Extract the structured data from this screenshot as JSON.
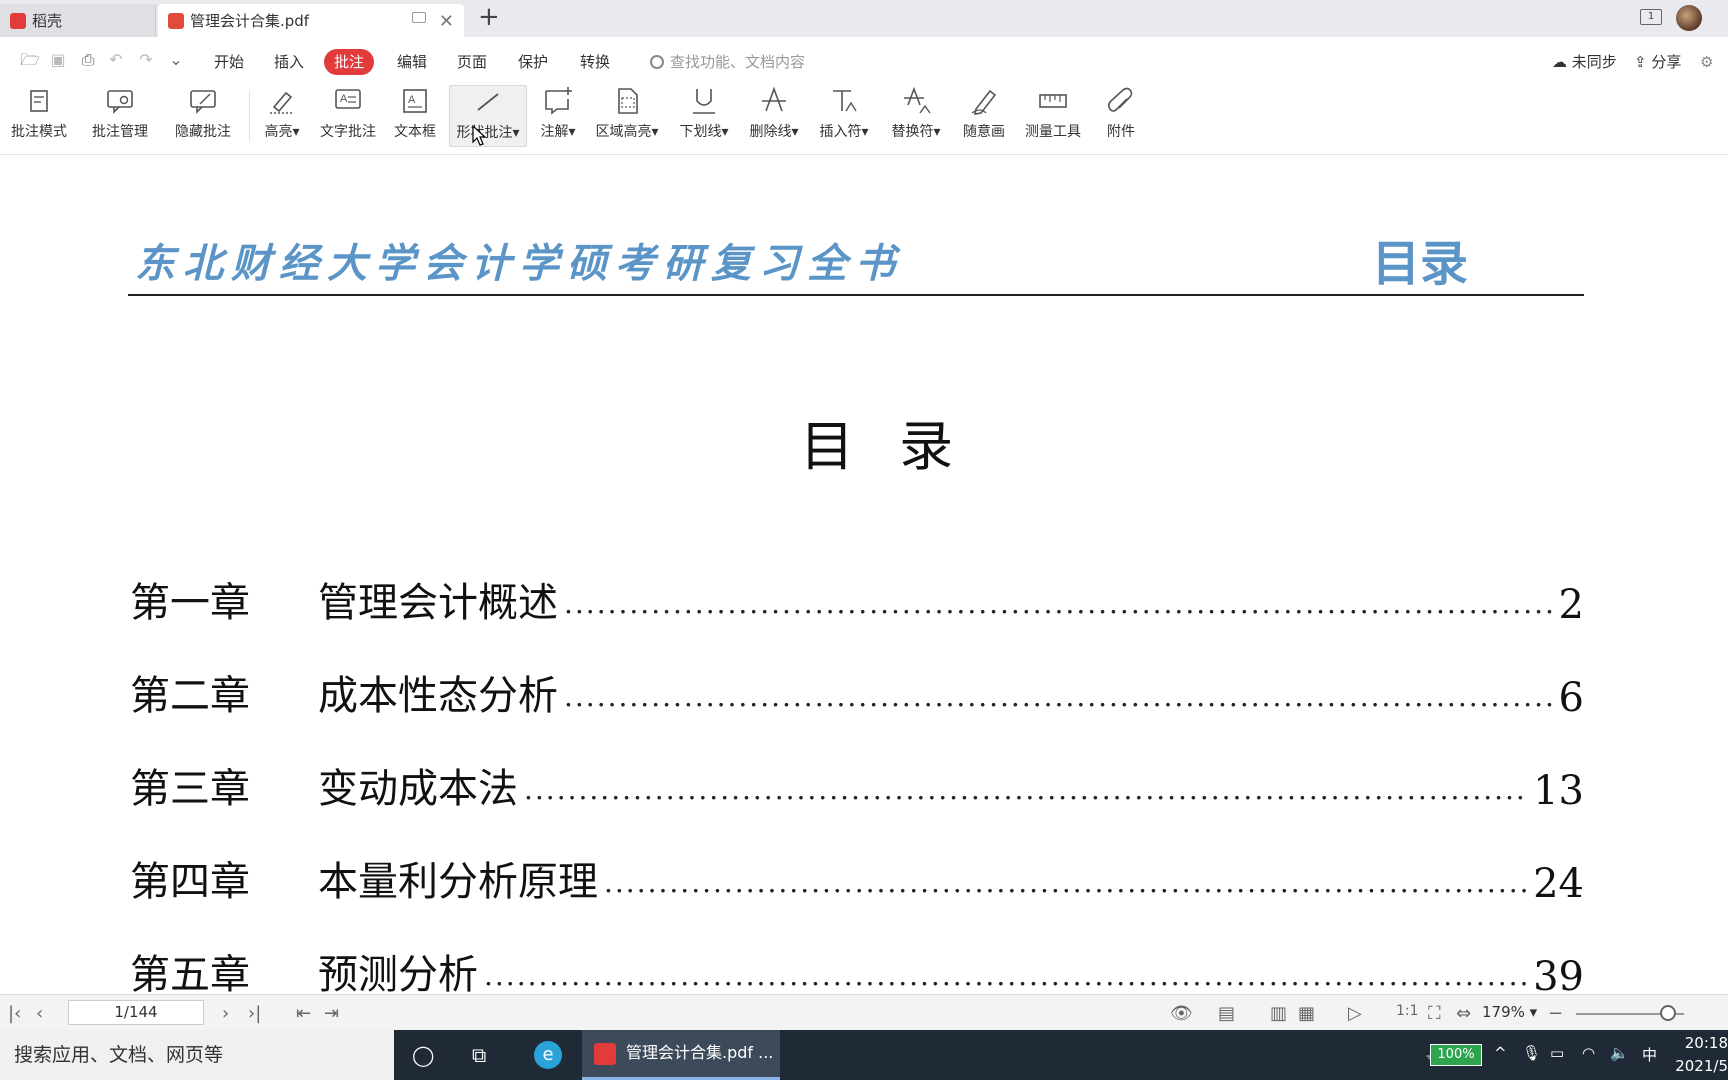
{
  "tabs": [
    {
      "label": "稻壳",
      "active": false
    },
    {
      "label": "管理会计合集.pdf",
      "active": true
    }
  ],
  "menu": {
    "items": [
      "开始",
      "插入",
      "批注",
      "编辑",
      "页面",
      "保护",
      "转换"
    ],
    "active_index": 2,
    "search_placeholder": "查找功能、文档内容",
    "sync_label": "未同步",
    "share_label": "分享"
  },
  "ribbon": {
    "buttons": [
      {
        "label": "批注模式",
        "icon": "annotation-mode-icon"
      },
      {
        "label": "批注管理",
        "icon": "annotation-manage-icon"
      },
      {
        "label": "隐藏批注",
        "icon": "hide-annotation-icon"
      },
      {
        "label": "高亮",
        "icon": "highlight-icon",
        "dropdown": true
      },
      {
        "label": "文字批注",
        "icon": "text-comment-icon"
      },
      {
        "label": "文本框",
        "icon": "textbox-icon"
      },
      {
        "label": "形状批注",
        "icon": "shape-annotation-icon",
        "dropdown": true,
        "hovered": true
      },
      {
        "label": "注解",
        "icon": "note-icon",
        "dropdown": true
      },
      {
        "label": "区域高亮",
        "icon": "area-highlight-icon",
        "dropdown": true
      },
      {
        "label": "下划线",
        "icon": "underline-icon",
        "dropdown": true
      },
      {
        "label": "删除线",
        "icon": "strikethrough-icon",
        "dropdown": true
      },
      {
        "label": "插入符",
        "icon": "insert-caret-icon",
        "dropdown": true
      },
      {
        "label": "替换符",
        "icon": "replace-caret-icon",
        "dropdown": true
      },
      {
        "label": "随意画",
        "icon": "freehand-icon"
      },
      {
        "label": "测量工具",
        "icon": "ruler-icon"
      },
      {
        "label": "附件",
        "icon": "paperclip-icon"
      }
    ]
  },
  "document": {
    "header_title": "东北财经大学会计学硕考研复习全书",
    "header_right": "目录",
    "page_title": "目 录",
    "toc": [
      {
        "chapter": "第一章",
        "title": "管理会计概述",
        "page": "2"
      },
      {
        "chapter": "第二章",
        "title": "成本性态分析",
        "page": "6"
      },
      {
        "chapter": "第三章",
        "title": "变动成本法",
        "page": "13"
      },
      {
        "chapter": "第四章",
        "title": "本量利分析原理",
        "page": "24"
      },
      {
        "chapter": "第五章",
        "title": "预测分析",
        "page": "39"
      }
    ]
  },
  "statusbar": {
    "page_indicator": "1/144",
    "zoom": "179%"
  },
  "taskbar": {
    "search_placeholder": "搜索应用、文档、网页等",
    "active_app": "管理会计合集.pdf ...",
    "battery": "100%",
    "ime": "中",
    "time": "20:18",
    "date": "2021/5"
  },
  "colors": {
    "accent_red": "#e23b3b",
    "header_blue": "#5b95c8",
    "taskbar": "#1f2a36"
  }
}
